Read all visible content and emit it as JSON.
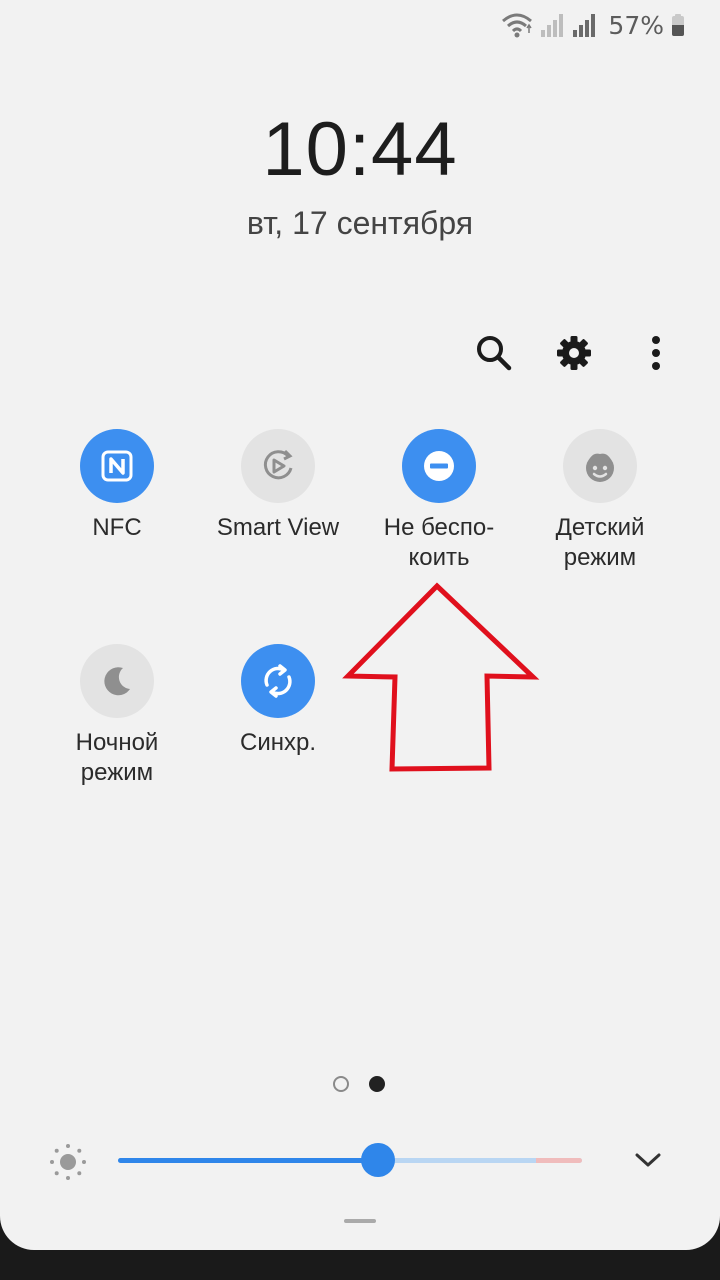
{
  "status_bar": {
    "battery_text": "57%",
    "battery_level": 0.57
  },
  "lock": {
    "time": "10:44",
    "date": "вт, 17 сентября"
  },
  "top_actions": {
    "search_icon": "search-icon",
    "settings_icon": "gear-icon",
    "more_icon": "more-vertical-icon"
  },
  "tiles": [
    {
      "label": "NFC",
      "state": "on",
      "icon": "nfc-icon"
    },
    {
      "label": "Smart View",
      "state": "off",
      "icon": "smart-view-icon"
    },
    {
      "label": "Не беспо-\nкоить",
      "state": "on",
      "icon": "do-not-disturb-icon"
    },
    {
      "label": "Детский\nрежим",
      "state": "off",
      "icon": "kids-mode-icon"
    },
    {
      "label": "Ночной\nрежим",
      "state": "off",
      "icon": "moon-icon"
    },
    {
      "label": "Синхр.",
      "state": "on",
      "icon": "sync-icon"
    }
  ],
  "pagination": {
    "total": 2,
    "current": 2
  },
  "brightness": {
    "level": 0.56,
    "warn_from": 0.9
  },
  "colors": {
    "accent": "#3d8ff0",
    "annotation": "#e0101d",
    "panel_background": "#f2f2f2"
  }
}
